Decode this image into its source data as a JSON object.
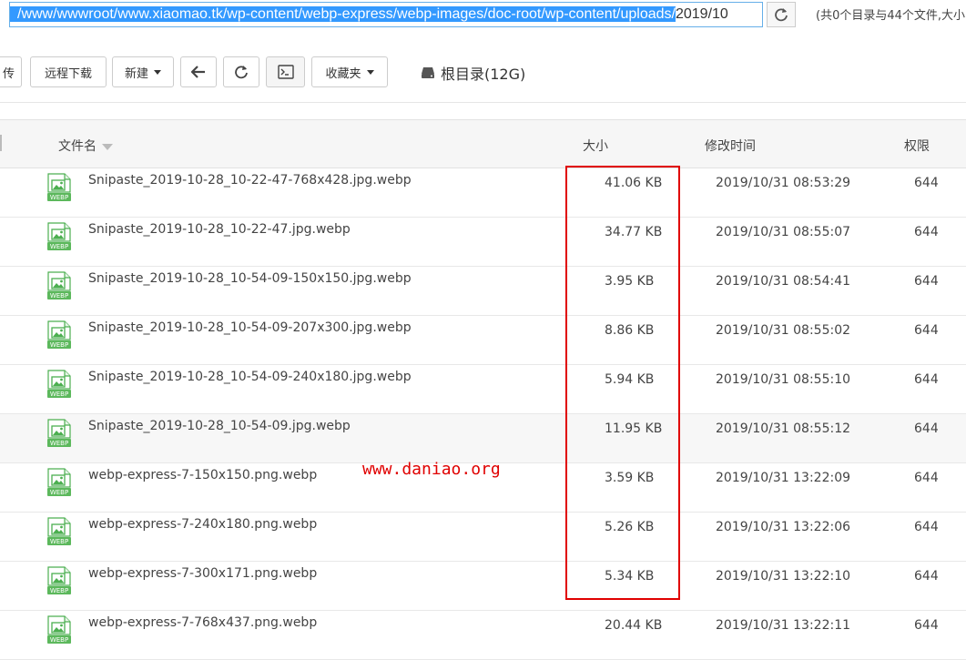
{
  "address": {
    "selected": "/www/wwwroot/www.xiaomao.tk/wp-content/webp-express/webp-images/doc-root/wp-content/uploads/",
    "rest": "2019/10"
  },
  "summary": "(共0个目录与44个文件,大小",
  "toolbar": {
    "upload_partial": "传",
    "remote_download": "远程下载",
    "new": "新建",
    "favorites": "收藏夹",
    "root_dir": "根目录(12G)"
  },
  "columns": {
    "filename": "文件名",
    "size": "大小",
    "mtime": "修改时间",
    "perm": "权限"
  },
  "icon_label": "WEBP",
  "files": [
    {
      "name": "Snipaste_2019-10-28_10-22-47-768x428.jpg.webp",
      "size": "41.06 KB",
      "mtime": "2019/10/31 08:53:29",
      "perm": "644"
    },
    {
      "name": "Snipaste_2019-10-28_10-22-47.jpg.webp",
      "size": "34.77 KB",
      "mtime": "2019/10/31 08:55:07",
      "perm": "644"
    },
    {
      "name": "Snipaste_2019-10-28_10-54-09-150x150.jpg.webp",
      "size": "3.95 KB",
      "mtime": "2019/10/31 08:54:41",
      "perm": "644"
    },
    {
      "name": "Snipaste_2019-10-28_10-54-09-207x300.jpg.webp",
      "size": "8.86 KB",
      "mtime": "2019/10/31 08:55:02",
      "perm": "644"
    },
    {
      "name": "Snipaste_2019-10-28_10-54-09-240x180.jpg.webp",
      "size": "5.94 KB",
      "mtime": "2019/10/31 08:55:10",
      "perm": "644"
    },
    {
      "name": "Snipaste_2019-10-28_10-54-09.jpg.webp",
      "size": "11.95 KB",
      "mtime": "2019/10/31 08:55:12",
      "perm": "644"
    },
    {
      "name": "webp-express-7-150x150.png.webp",
      "size": "3.59 KB",
      "mtime": "2019/10/31 13:22:09",
      "perm": "644"
    },
    {
      "name": "webp-express-7-240x180.png.webp",
      "size": "5.26 KB",
      "mtime": "2019/10/31 13:22:06",
      "perm": "644"
    },
    {
      "name": "webp-express-7-300x171.png.webp",
      "size": "5.34 KB",
      "mtime": "2019/10/31 13:22:10",
      "perm": "644"
    },
    {
      "name": "webp-express-7-768x437.png.webp",
      "size": "20.44 KB",
      "mtime": "2019/10/31 13:22:11",
      "perm": "644"
    }
  ],
  "watermark": "www.daniao.org",
  "colors": {
    "highlight_box": "#e00000",
    "selection": "#3399ff",
    "icon_green": "#4caf50"
  }
}
